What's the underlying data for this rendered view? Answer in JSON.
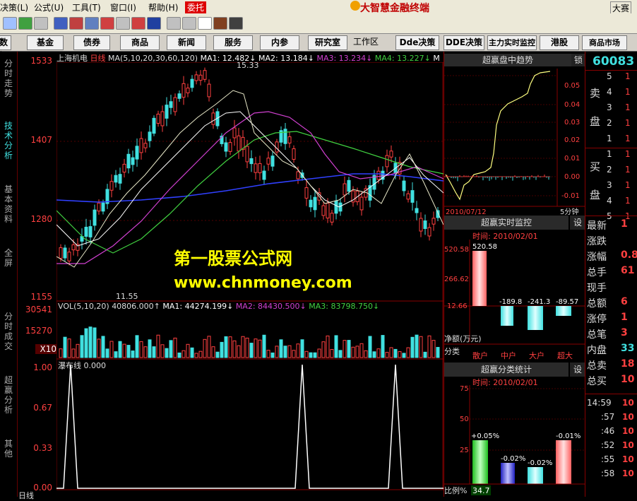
{
  "menu": {
    "items": [
      "决策(L)",
      "公式(U)",
      "工具(T)",
      "窗口(I)",
      "帮助(H)"
    ],
    "entrust": "委托",
    "app_title": "大智慧金融终端",
    "mode": "大赛"
  },
  "navbar": {
    "items": [
      "数据",
      "基金",
      "债券",
      "商品",
      "新闻",
      "服务",
      "内参",
      "研究室"
    ],
    "workspace": "工作区",
    "right_items": [
      "Dde决策",
      "DDE决策",
      "主力实时监控",
      "港股",
      "商品市场"
    ]
  },
  "sidetabs": [
    "分时走势",
    "技术分析",
    "基本资料",
    "全屏",
    "分时成交",
    "超赢分析",
    "其他"
  ],
  "main_chart": {
    "stock": "上海机电",
    "period": "日线",
    "ma_label": "MA(5,10,20,30,60,120)",
    "ma_values": [
      {
        "label": "MA1: 12.482↓",
        "color": "#ffffff"
      },
      {
        "label": "MA2: 13.184↓",
        "color": "#ffffff"
      },
      {
        "label": "MA3: 13.234↓",
        "color": "#d040d0"
      },
      {
        "label": "MA4: 13.227↓",
        "color": "#40d040"
      },
      {
        "label": "M",
        "color": "#ffffff"
      }
    ],
    "yticks": [
      "1533",
      "1407",
      "1280",
      "1155"
    ],
    "high_label": "15.33",
    "low_label": "11.55",
    "watermark_title": "第一股票公式网",
    "watermark_url": "www.chnmoney.com"
  },
  "volume": {
    "label": "VOL(5,10,20)",
    "value": "40806.000↑",
    "mas": [
      {
        "label": "MA1: 44274.199↓",
        "color": "#ffffff"
      },
      {
        "label": "MA2: 84430.500↓",
        "color": "#d040d0"
      },
      {
        "label": "MA3: 83798.750↓",
        "color": "#40d040"
      }
    ],
    "yticks": [
      "30541",
      "15270"
    ],
    "unit": "X10"
  },
  "indicator": {
    "label": "瀑布线 0.000",
    "yticks": [
      "1.00",
      "0.67",
      "0.33",
      "0.00"
    ]
  },
  "trend_panel": {
    "title": "超赢盘中趋势",
    "lock": "锁",
    "yticks": [
      "0.05",
      "0.04",
      "0.03",
      "0.02",
      "0.01",
      "0.00",
      "-0.01"
    ],
    "date": "2010/07/12",
    "period": "5分钟"
  },
  "monitor_panel": {
    "title": "超赢实时监控",
    "setting": "设",
    "time": "时间: 2010/02/01",
    "yticks": [
      "520.58",
      "266.62",
      "12.66"
    ],
    "bar_values": [
      "520.58",
      "-189.8",
      "-241.3",
      "-89.57"
    ],
    "axis_title": "净额(万元)",
    "category_label": "分类",
    "categories": [
      "散户",
      "中户",
      "大户",
      "超大"
    ]
  },
  "stats_panel": {
    "title": "超赢分类统计",
    "setting": "设",
    "time": "时间: 2010/02/01",
    "yticks": [
      "75",
      "50",
      "25"
    ],
    "bar_values": [
      "+0.05%",
      "-0.02%",
      "-0.02%",
      "-0.01%"
    ],
    "ratio_label": "比例%",
    "ratio_value": "34.7"
  },
  "quote_panel": {
    "code": "60083",
    "sell_label": [
      "卖",
      "盘"
    ],
    "sell_levels": [
      "5",
      "4",
      "3",
      "2",
      "1"
    ],
    "sell_vals": [
      "1",
      "1",
      "1",
      "1",
      "1"
    ],
    "buy_label": [
      "买",
      "盘"
    ],
    "buy_levels": [
      "1",
      "2",
      "3",
      "4",
      "5"
    ],
    "buy_vals": [
      "1",
      "1",
      "1",
      "1",
      "1"
    ],
    "fields": [
      {
        "label": "最新",
        "value": "1"
      },
      {
        "label": "涨跌",
        "value": ""
      },
      {
        "label": "涨幅",
        "value": "0.8"
      },
      {
        "label": "总手",
        "value": "61"
      },
      {
        "label": "现手",
        "value": ""
      },
      {
        "label": "总额",
        "value": "6"
      },
      {
        "label": "涨停",
        "value": "1"
      },
      {
        "label": "总笔",
        "value": "3"
      },
      {
        "label": "内盘",
        "value": "33"
      },
      {
        "label": "总卖",
        "value": "18"
      },
      {
        "label": "总买",
        "value": "10"
      }
    ],
    "ticks": [
      {
        "time": "14:59",
        "value": "10"
      },
      {
        "time": ":57",
        "value": "10"
      },
      {
        "time": ":46",
        "value": "10"
      },
      {
        "time": ":52",
        "value": "10"
      },
      {
        "time": ":55",
        "value": "10"
      },
      {
        "time": ":58",
        "value": "10"
      }
    ]
  },
  "footer": {
    "left": "日线"
  },
  "colors": {
    "up": "#ff4040",
    "down": "#40e0e0",
    "ma_blue": "#3040ff",
    "ma_green": "#40d040",
    "ma_purple": "#d040d0"
  }
}
